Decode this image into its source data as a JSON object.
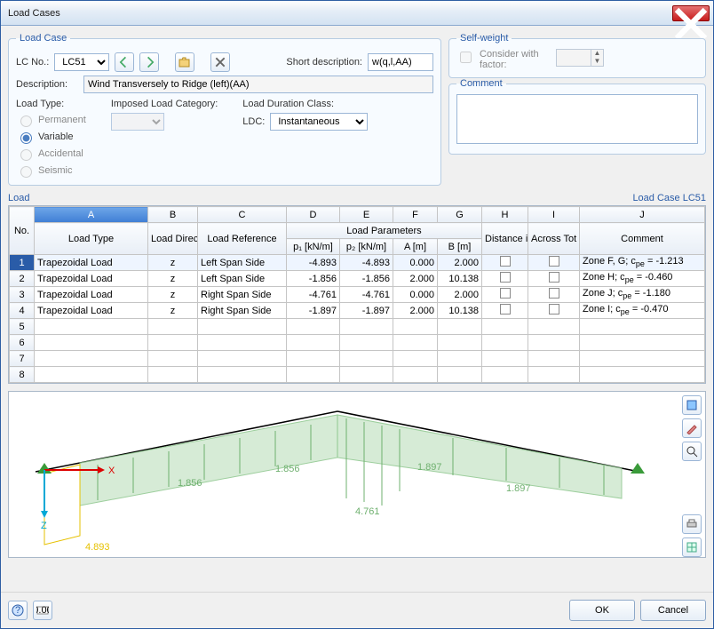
{
  "window": {
    "title": "Load Cases"
  },
  "loadCase": {
    "legend": "Load Case",
    "lcNoLabel": "LC No.:",
    "lcNoValue": "LC51",
    "shortDescLabel": "Short description:",
    "shortDescValue": "w(q,l,AA)",
    "descLabel": "Description:",
    "descValue": "Wind Transversely to Ridge (left)(AA)",
    "loadTypeLabel": "Load Type:",
    "imposedLabel": "Imposed Load Category:",
    "ldcLabel": "Load Duration Class:",
    "ldcPrefix": "LDC:",
    "ldcValue": "Instantaneous",
    "types": {
      "permanent": "Permanent",
      "variable": "Variable",
      "accidental": "Accidental",
      "seismic": "Seismic"
    }
  },
  "selfWeight": {
    "legend": "Self-weight",
    "considerLabel": "Consider with factor:"
  },
  "comment": {
    "legend": "Comment",
    "text": ""
  },
  "loadSection": {
    "legend": "Load",
    "caseLabel": "Load Case LC51"
  },
  "gridHeaders": {
    "no": "No.",
    "colLetters": [
      "A",
      "B",
      "C",
      "D",
      "E",
      "F",
      "G",
      "H",
      "I",
      "J"
    ],
    "loadType": "Load Type",
    "loadDirection": "Load Direction",
    "loadReference": "Load Reference",
    "loadParams": "Load Parameters",
    "p1": "p₁ [kN/m]",
    "p2": "p₂ [kN/m]",
    "a": "A [m]",
    "b": "B [m]",
    "distance": "Distance in %",
    "acrossTot": "Across Tot Length",
    "comment": "Comment"
  },
  "gridRows": [
    {
      "n": 1,
      "type": "Trapezoidal Load",
      "dir": "z",
      "ref": "Left Span Side",
      "p1": "-4.893",
      "p2": "-4.893",
      "a": "0.000",
      "b": "2.000",
      "dist": false,
      "across": false,
      "comment": "Zone F, G; cpe = -1.213"
    },
    {
      "n": 2,
      "type": "Trapezoidal Load",
      "dir": "z",
      "ref": "Left Span Side",
      "p1": "-1.856",
      "p2": "-1.856",
      "a": "2.000",
      "b": "10.138",
      "dist": false,
      "across": false,
      "comment": "Zone H; cpe = -0.460"
    },
    {
      "n": 3,
      "type": "Trapezoidal Load",
      "dir": "z",
      "ref": "Right Span Side",
      "p1": "-4.761",
      "p2": "-4.761",
      "a": "0.000",
      "b": "2.000",
      "dist": false,
      "across": false,
      "comment": "Zone J; cpe = -1.180"
    },
    {
      "n": 4,
      "type": "Trapezoidal Load",
      "dir": "z",
      "ref": "Right Span Side",
      "p1": "-1.897",
      "p2": "-1.897",
      "a": "2.000",
      "b": "10.138",
      "dist": false,
      "across": false,
      "comment": "Zone I; cpe = -0.470"
    }
  ],
  "emptyRows": [
    5,
    6,
    7,
    8
  ],
  "previewLabels": {
    "x": "X",
    "z": "Z",
    "l1": "1.856",
    "l2": "1.856",
    "l3": "4.761",
    "l4": "1.897",
    "l5": "1.897",
    "l6": "4.893"
  },
  "footer": {
    "ok": "OK",
    "cancel": "Cancel"
  }
}
